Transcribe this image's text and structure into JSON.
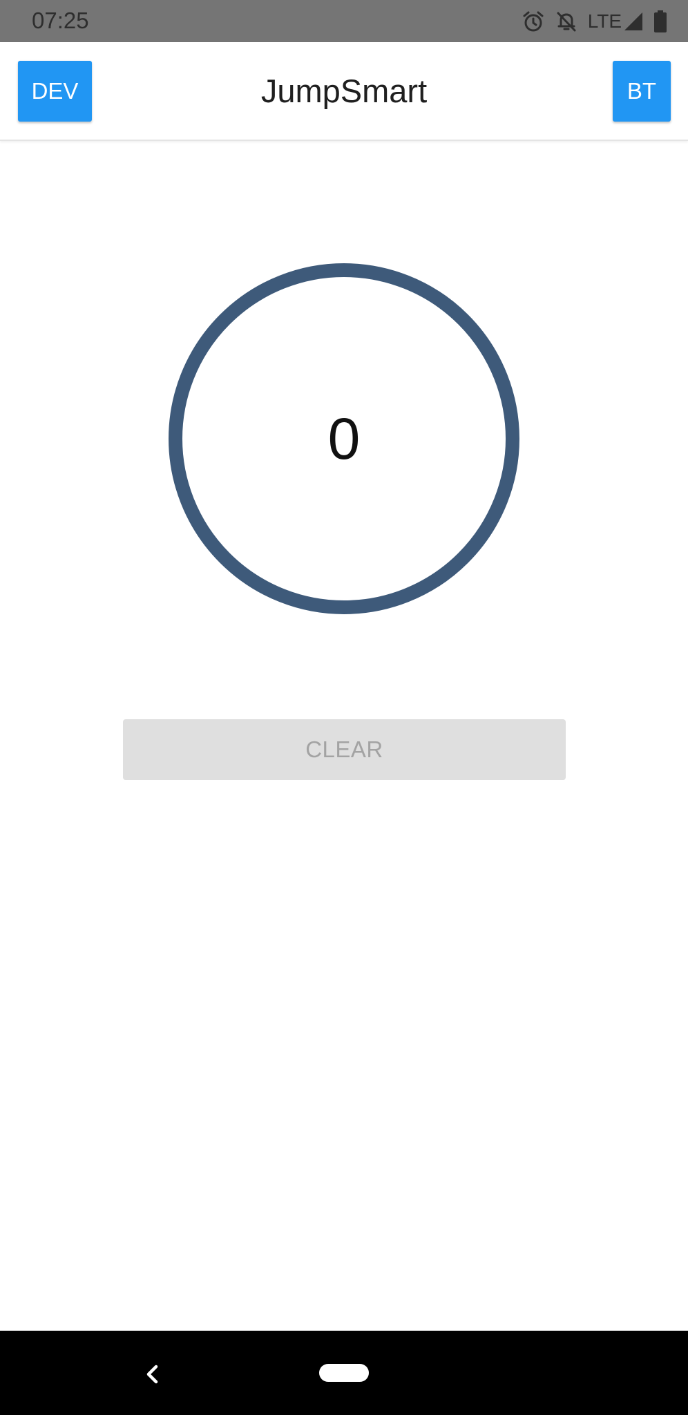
{
  "status_bar": {
    "time": "07:25",
    "network_label": "LTE",
    "icons": [
      "alarm-icon",
      "notifications-off-icon",
      "signal-icon",
      "battery-icon"
    ]
  },
  "app_bar": {
    "title": "JumpSmart",
    "left_button_label": "DEV",
    "right_button_label": "BT"
  },
  "counter": {
    "value": "0"
  },
  "actions": {
    "clear_label": "CLEAR"
  },
  "nav_bar": {
    "icons": [
      "back-icon",
      "home-pill-icon"
    ]
  },
  "colors": {
    "accent": "#2196f3",
    "ring": "#3e5a7a",
    "status_bar": "#757575",
    "disabled_button": "#dfdfdf",
    "disabled_text": "#a3a3a3"
  }
}
